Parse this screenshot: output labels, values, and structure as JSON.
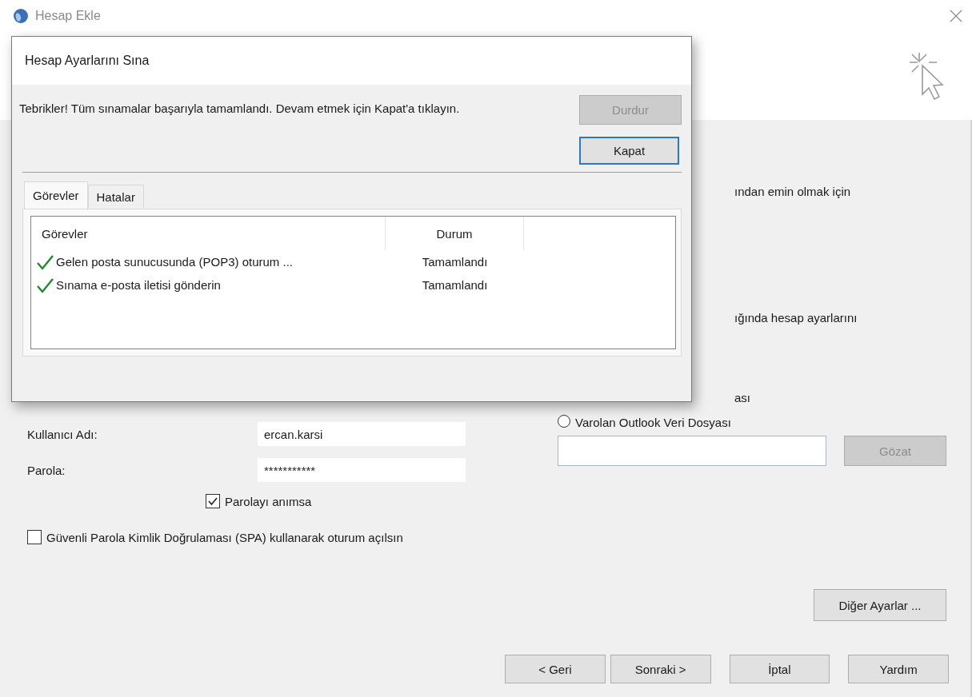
{
  "window": {
    "title": "Hesap Ekle"
  },
  "background": {
    "right_texts": [
      "ından emin olmak için",
      "ığında hesap ayarlarını",
      "ası"
    ],
    "radio": {
      "label": "Varolan Outlook Veri Dosyası",
      "selected": false
    },
    "browse_button": {
      "label": "Gözat",
      "disabled": true
    },
    "fields": [
      {
        "label": "Kullanıcı Adı:",
        "value": "ercan.karsi"
      },
      {
        "label": "Parola:",
        "value": "***********"
      }
    ],
    "checkboxes": [
      {
        "label": "Parolayı anımsa",
        "checked": true
      },
      {
        "label": "Güvenli Parola Kimlik Doğrulaması (SPA) kullanarak oturum açılsın",
        "checked": false
      }
    ],
    "more_settings_button": "Diğer Ayarlar ...",
    "footer_buttons": [
      "< Geri",
      "Sonraki >",
      "İptal",
      "Yardım"
    ]
  },
  "dialog": {
    "title": "Hesap Ayarlarını Sına",
    "message": "Tebrikler! Tüm sınamalar başarıyla tamamlandı. Devam etmek için Kapat'a tıklayın.",
    "buttons": [
      {
        "label": "Durdur",
        "disabled": true
      },
      {
        "label": "Kapat",
        "disabled": false
      }
    ],
    "tabs": [
      {
        "label": "Görevler",
        "selected": true
      },
      {
        "label": "Hatalar",
        "selected": false
      }
    ],
    "columns": [
      "Görevler",
      "Durum"
    ],
    "rows": [
      {
        "task": "Gelen posta sunucusunda (POP3) oturum ...",
        "status": "Tamamlandı",
        "completed": true
      },
      {
        "task": "Sınama e-posta iletisi gönderin",
        "status": "Tamamlandı",
        "completed": true
      }
    ]
  }
}
